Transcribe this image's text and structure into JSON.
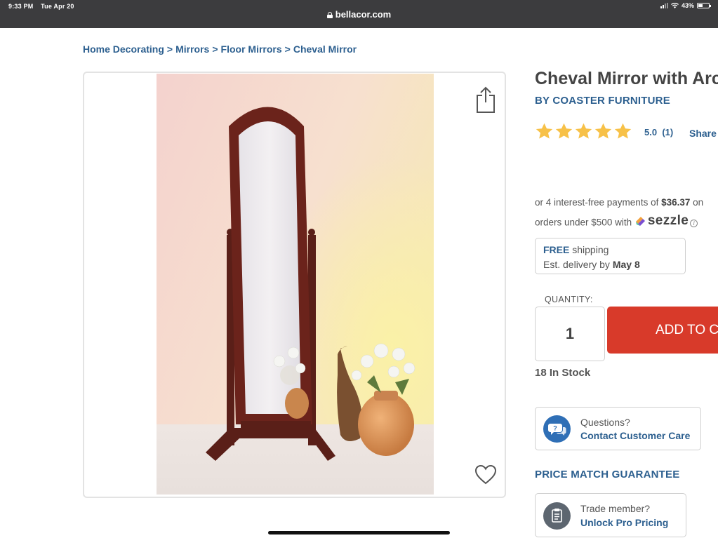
{
  "status_bar": {
    "time": "9:33 PM",
    "date": "Tue Apr 20",
    "battery": "43%",
    "battery_level": 0.43
  },
  "address_bar": {
    "url": "bellacor.com"
  },
  "breadcrumb": {
    "items": [
      "Home Decorating",
      "Mirrors",
      "Floor Mirrors",
      "Cheval Mirror"
    ],
    "separator": ">"
  },
  "product": {
    "title": "Cheval Mirror with Arched Top",
    "brand": "BY COASTER FURNITURE",
    "rating_stars": 5,
    "rating_value": "5.0",
    "review_count": "(1)",
    "share_label": "Share",
    "installments_prefix": "or 4 interest-free payments of ",
    "installment_amount": "$36.37",
    "installments_on": " on",
    "installments_line2": "orders under $500 with ",
    "sezzle_label": "sezzle",
    "info_glyph": "i",
    "shipping_free": "FREE",
    "shipping_suffix": " shipping",
    "delivery_prefix": "Est. delivery by ",
    "delivery_date": "May 8",
    "quantity_label": "QUANTITY:",
    "quantity_value": "1",
    "add_to_cart_label": "ADD TO CART",
    "stock_text": "18 In Stock",
    "questions_label": "Questions?",
    "contact_label": "Contact Customer Care",
    "price_match_label": "PRICE MATCH GUARANTEE",
    "trade_label": "Trade member?",
    "pro_pricing_label": "Unlock Pro Pricing"
  },
  "colors": {
    "link_blue": "#2c5f8f",
    "cta_red": "#d83a2a",
    "star_gold": "#f7c148",
    "care_blue": "#2f6fb6",
    "trade_gray": "#5d6670"
  },
  "icons": {
    "lock": "lock-icon",
    "share": "share-icon",
    "heart": "heart-icon",
    "star": "star-icon",
    "chat": "chat-bubble-icon",
    "clipboard": "clipboard-icon",
    "info": "info-icon"
  }
}
